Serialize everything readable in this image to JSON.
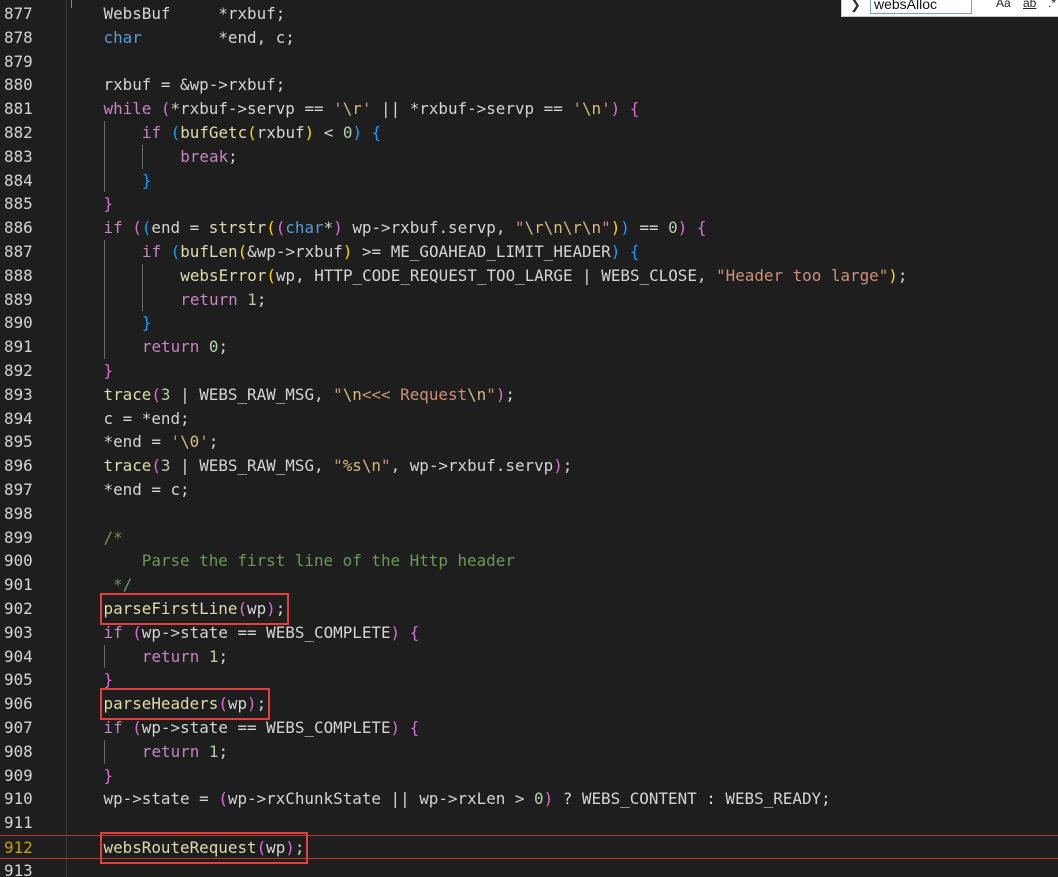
{
  "find": {
    "value": "websAlloc",
    "toggle_icon": "chevron-right-icon",
    "match_case_label": "Aa",
    "whole_word_label": "ab",
    "regex_label": ".*"
  },
  "current_line": 912,
  "highlight_color": "#e04040",
  "lines": [
    {
      "n": 877,
      "indent": 0,
      "tokens": [
        [
          "WebsBuf     ",
          "mac"
        ],
        [
          "*",
          "mac"
        ],
        [
          "rxbuf",
          "mac"
        ],
        [
          ";",
          "mac"
        ]
      ]
    },
    {
      "n": 878,
      "indent": 0,
      "tokens": [
        [
          "char",
          "ty"
        ],
        [
          "        ",
          "mac"
        ],
        [
          "*end, c;",
          "mac"
        ]
      ]
    },
    {
      "n": 879,
      "indent": 0,
      "tokens": []
    },
    {
      "n": 880,
      "indent": 0,
      "tokens": [
        [
          "rxbuf = &wp->rxbuf;",
          "mac"
        ]
      ]
    },
    {
      "n": 881,
      "indent": 0,
      "tokens": [
        [
          "while",
          "ctl"
        ],
        [
          " ",
          "mac"
        ],
        [
          "(",
          "p2"
        ],
        [
          "*rxbuf->servp == ",
          "mac"
        ],
        [
          "'",
          "str"
        ],
        [
          "\\r",
          "esc"
        ],
        [
          "'",
          "str"
        ],
        [
          " || *rxbuf->servp == ",
          "mac"
        ],
        [
          "'",
          "str"
        ],
        [
          "\\n",
          "esc"
        ],
        [
          "'",
          "str"
        ],
        [
          ")",
          "p2"
        ],
        [
          " ",
          "mac"
        ],
        [
          "{",
          "p2"
        ]
      ]
    },
    {
      "n": 882,
      "indent": 1,
      "tokens": [
        [
          "if",
          "ctl"
        ],
        [
          " ",
          "mac"
        ],
        [
          "(",
          "p3"
        ],
        [
          "bufGetc",
          "fn"
        ],
        [
          "(",
          "p1"
        ],
        [
          "rxbuf",
          "mac"
        ],
        [
          ")",
          "p1"
        ],
        [
          " < ",
          "mac"
        ],
        [
          "0",
          "num"
        ],
        [
          ")",
          "p3"
        ],
        [
          " ",
          "mac"
        ],
        [
          "{",
          "p3"
        ]
      ]
    },
    {
      "n": 883,
      "indent": 2,
      "tokens": [
        [
          "break",
          "ctl"
        ],
        [
          ";",
          "mac"
        ]
      ]
    },
    {
      "n": 884,
      "indent": 1,
      "tokens": [
        [
          "}",
          "p3"
        ]
      ]
    },
    {
      "n": 885,
      "indent": 0,
      "tokens": [
        [
          "}",
          "p2"
        ]
      ]
    },
    {
      "n": 886,
      "indent": 0,
      "tokens": [
        [
          "if",
          "ctl"
        ],
        [
          " ",
          "mac"
        ],
        [
          "(",
          "p2"
        ],
        [
          "(",
          "p3"
        ],
        [
          "end = ",
          "mac"
        ],
        [
          "strstr",
          "fn"
        ],
        [
          "(",
          "p1"
        ],
        [
          "(",
          "p2"
        ],
        [
          "char",
          "ty"
        ],
        [
          "*",
          "mac"
        ],
        [
          ")",
          "p2"
        ],
        [
          " wp->rxbuf.servp, ",
          "mac"
        ],
        [
          "\"",
          "str"
        ],
        [
          "\\r\\n\\r\\n",
          "esc"
        ],
        [
          "\"",
          "str"
        ],
        [
          ")",
          "p1"
        ],
        [
          ")",
          "p3"
        ],
        [
          " == ",
          "mac"
        ],
        [
          "0",
          "num"
        ],
        [
          ")",
          "p2"
        ],
        [
          " ",
          "mac"
        ],
        [
          "{",
          "p2"
        ]
      ]
    },
    {
      "n": 887,
      "indent": 1,
      "tokens": [
        [
          "if",
          "ctl"
        ],
        [
          " ",
          "mac"
        ],
        [
          "(",
          "p3"
        ],
        [
          "bufLen",
          "fn"
        ],
        [
          "(",
          "p1"
        ],
        [
          "&wp->rxbuf",
          "mac"
        ],
        [
          ")",
          "p1"
        ],
        [
          " >= ME_GOAHEAD_LIMIT_HEADER",
          "mac"
        ],
        [
          ")",
          "p3"
        ],
        [
          " ",
          "mac"
        ],
        [
          "{",
          "p3"
        ]
      ]
    },
    {
      "n": 888,
      "indent": 2,
      "tokens": [
        [
          "websError",
          "fn"
        ],
        [
          "(",
          "p1"
        ],
        [
          "wp, HTTP_CODE_REQUEST_TOO_LARGE | WEBS_CLOSE, ",
          "mac"
        ],
        [
          "\"Header too large\"",
          "str"
        ],
        [
          ")",
          "p1"
        ],
        [
          ";",
          "mac"
        ]
      ]
    },
    {
      "n": 889,
      "indent": 2,
      "tokens": [
        [
          "return",
          "ctl"
        ],
        [
          " ",
          "mac"
        ],
        [
          "1",
          "num"
        ],
        [
          ";",
          "mac"
        ]
      ]
    },
    {
      "n": 890,
      "indent": 1,
      "tokens": [
        [
          "}",
          "p3"
        ]
      ]
    },
    {
      "n": 891,
      "indent": 1,
      "tokens": [
        [
          "return",
          "ctl"
        ],
        [
          " ",
          "mac"
        ],
        [
          "0",
          "num"
        ],
        [
          ";",
          "mac"
        ]
      ]
    },
    {
      "n": 892,
      "indent": 0,
      "tokens": [
        [
          "}",
          "p2"
        ]
      ]
    },
    {
      "n": 893,
      "indent": 0,
      "tokens": [
        [
          "trace",
          "fn"
        ],
        [
          "(",
          "p2"
        ],
        [
          "3",
          "num"
        ],
        [
          " | WEBS_RAW_MSG, ",
          "mac"
        ],
        [
          "\"",
          "str"
        ],
        [
          "\\n",
          "esc"
        ],
        [
          "<<< Request",
          "str"
        ],
        [
          "\\n",
          "esc"
        ],
        [
          "\"",
          "str"
        ],
        [
          ")",
          "p2"
        ],
        [
          ";",
          "mac"
        ]
      ]
    },
    {
      "n": 894,
      "indent": 0,
      "tokens": [
        [
          "c = *end;",
          "mac"
        ]
      ]
    },
    {
      "n": 895,
      "indent": 0,
      "tokens": [
        [
          "*end = ",
          "mac"
        ],
        [
          "'",
          "str"
        ],
        [
          "\\0",
          "esc"
        ],
        [
          "'",
          "str"
        ],
        [
          ";",
          "mac"
        ]
      ]
    },
    {
      "n": 896,
      "indent": 0,
      "tokens": [
        [
          "trace",
          "fn"
        ],
        [
          "(",
          "p2"
        ],
        [
          "3",
          "num"
        ],
        [
          " | WEBS_RAW_MSG, ",
          "mac"
        ],
        [
          "\"",
          "str"
        ],
        [
          "%s",
          "esc"
        ],
        [
          "\\n",
          "esc"
        ],
        [
          "\"",
          "str"
        ],
        [
          ", wp->rxbuf.servp",
          "mac"
        ],
        [
          ")",
          "p2"
        ],
        [
          ";",
          "mac"
        ]
      ]
    },
    {
      "n": 897,
      "indent": 0,
      "tokens": [
        [
          "*end = c;",
          "mac"
        ]
      ]
    },
    {
      "n": 898,
      "indent": 0,
      "tokens": []
    },
    {
      "n": 899,
      "indent": 0,
      "tokens": [
        [
          "/*",
          "cm"
        ]
      ]
    },
    {
      "n": 900,
      "indent": 0,
      "tokens": [
        [
          "    Parse the first line of the Http header",
          "cm"
        ]
      ]
    },
    {
      "n": 901,
      "indent": 0,
      "tokens": [
        [
          " */",
          "cm"
        ]
      ]
    },
    {
      "n": 902,
      "indent": 0,
      "highlight": true,
      "tokens": [
        [
          "parseFirstLine",
          "fn"
        ],
        [
          "(",
          "p2"
        ],
        [
          "wp",
          "mac"
        ],
        [
          ")",
          "p2"
        ],
        [
          ";",
          "mac"
        ]
      ]
    },
    {
      "n": 903,
      "indent": 0,
      "tokens": [
        [
          "if",
          "ctl"
        ],
        [
          " ",
          "mac"
        ],
        [
          "(",
          "p2"
        ],
        [
          "wp->state == WEBS_COMPLETE",
          "mac"
        ],
        [
          ")",
          "p2"
        ],
        [
          " ",
          "mac"
        ],
        [
          "{",
          "p2"
        ]
      ]
    },
    {
      "n": 904,
      "indent": 1,
      "tokens": [
        [
          "return",
          "ctl"
        ],
        [
          " ",
          "mac"
        ],
        [
          "1",
          "num"
        ],
        [
          ";",
          "mac"
        ]
      ]
    },
    {
      "n": 905,
      "indent": 0,
      "tokens": [
        [
          "}",
          "p2"
        ]
      ]
    },
    {
      "n": 906,
      "indent": 0,
      "highlight": true,
      "tokens": [
        [
          "parseHeaders",
          "fn"
        ],
        [
          "(",
          "p2"
        ],
        [
          "wp",
          "mac"
        ],
        [
          ")",
          "p2"
        ],
        [
          ";",
          "mac"
        ]
      ]
    },
    {
      "n": 907,
      "indent": 0,
      "tokens": [
        [
          "if",
          "ctl"
        ],
        [
          " ",
          "mac"
        ],
        [
          "(",
          "p2"
        ],
        [
          "wp->state == WEBS_COMPLETE",
          "mac"
        ],
        [
          ")",
          "p2"
        ],
        [
          " ",
          "mac"
        ],
        [
          "{",
          "p2"
        ]
      ]
    },
    {
      "n": 908,
      "indent": 1,
      "tokens": [
        [
          "return",
          "ctl"
        ],
        [
          " ",
          "mac"
        ],
        [
          "1",
          "num"
        ],
        [
          ";",
          "mac"
        ]
      ]
    },
    {
      "n": 909,
      "indent": 0,
      "tokens": [
        [
          "}",
          "p2"
        ]
      ]
    },
    {
      "n": 910,
      "indent": 0,
      "tokens": [
        [
          "wp->state = ",
          "mac"
        ],
        [
          "(",
          "p2"
        ],
        [
          "wp->rxChunkState || wp->rxLen > ",
          "mac"
        ],
        [
          "0",
          "num"
        ],
        [
          ")",
          "p2"
        ],
        [
          " ? WEBS_CONTENT : WEBS_READY;",
          "mac"
        ]
      ]
    },
    {
      "n": 911,
      "indent": 0,
      "tokens": []
    },
    {
      "n": 912,
      "indent": 0,
      "highlight": true,
      "tokens": [
        [
          "websRouteRequest",
          "fn"
        ],
        [
          "(",
          "p2"
        ],
        [
          "wp",
          "mac"
        ],
        [
          ")",
          "p2"
        ],
        [
          ";",
          "mac"
        ]
      ]
    },
    {
      "n": 913,
      "indent": 0,
      "tokens": []
    }
  ]
}
